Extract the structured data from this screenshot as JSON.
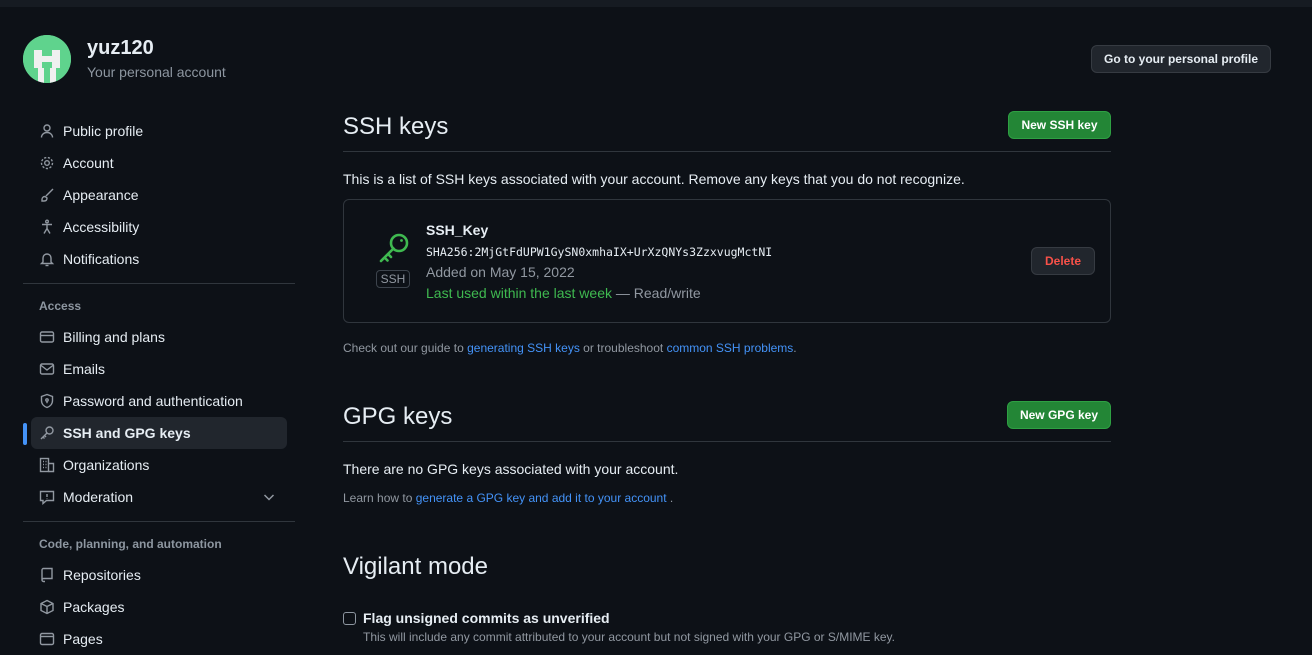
{
  "profile": {
    "username": "yuz120",
    "subtitle": "Your personal account",
    "profile_button": "Go to your personal profile"
  },
  "sidebar": {
    "items": [
      {
        "label": "Public profile",
        "icon": "person-icon"
      },
      {
        "label": "Account",
        "icon": "gear-icon"
      },
      {
        "label": "Appearance",
        "icon": "paintbrush-icon"
      },
      {
        "label": "Accessibility",
        "icon": "accessibility-icon"
      },
      {
        "label": "Notifications",
        "icon": "bell-icon"
      }
    ],
    "access_title": "Access",
    "access_items": [
      {
        "label": "Billing and plans",
        "icon": "credit-card-icon"
      },
      {
        "label": "Emails",
        "icon": "mail-icon"
      },
      {
        "label": "Password and authentication",
        "icon": "shield-lock-icon"
      },
      {
        "label": "SSH and GPG keys",
        "icon": "key-icon",
        "active": true
      },
      {
        "label": "Organizations",
        "icon": "organization-icon"
      },
      {
        "label": "Moderation",
        "icon": "report-icon"
      }
    ],
    "code_title": "Code, planning, and automation",
    "code_items": [
      {
        "label": "Repositories",
        "icon": "repo-icon"
      },
      {
        "label": "Packages",
        "icon": "package-icon"
      },
      {
        "label": "Pages",
        "icon": "browser-icon"
      }
    ]
  },
  "ssh": {
    "title": "SSH keys",
    "new_button": "New SSH key",
    "description": "This is a list of SSH keys associated with your account. Remove any keys that you do not recognize.",
    "key": {
      "badge": "SSH",
      "name": "SSH_Key",
      "fingerprint": "SHA256:2MjGtFdUPW1GySN0xmhaIX+UrXzQNYs3ZzxvugMctNI",
      "added": "Added on May 15, 2022",
      "last_used": "Last used within the last week",
      "access": "— Read/write",
      "delete_label": "Delete"
    },
    "guide_prefix": "Check out our guide to",
    "guide_link1": "generating SSH keys",
    "guide_middle": "or troubleshoot",
    "guide_link2": "common SSH problems",
    "guide_suffix": "."
  },
  "gpg": {
    "title": "GPG keys",
    "new_button": "New GPG key",
    "empty_text": "There are no GPG keys associated with your account.",
    "learn_prefix": "Learn how to",
    "learn_link": "generate a GPG key and add it to your account",
    "learn_suffix": "."
  },
  "vigilant": {
    "title": "Vigilant mode",
    "checkbox_label": "Flag unsigned commits as unverified",
    "checkbox_checked": false,
    "note": "This will include any commit attributed to your account but not signed with your GPG or S/MIME key."
  },
  "colors": {
    "background": "#0d1117",
    "accent_blue": "#4493f8",
    "primary_green": "#238636",
    "danger_red": "#f85149",
    "avatar_green": "#5fd38d"
  }
}
